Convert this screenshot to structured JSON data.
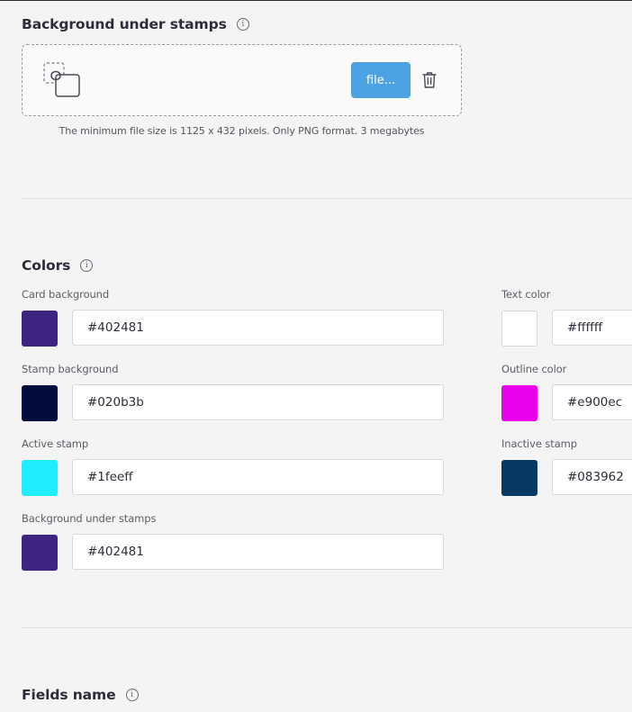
{
  "background_section": {
    "title": "Background under stamps",
    "file_button_label": "file...",
    "hint": "The minimum file size is 1125 x 432 pixels. Only PNG format. 3 megabytes"
  },
  "colors_section": {
    "title": "Colors",
    "fields": {
      "card_background": {
        "label": "Card background",
        "value": "#402481",
        "swatch": "#402481"
      },
      "text_color": {
        "label": "Text color",
        "value": "#ffffff",
        "swatch": "#ffffff"
      },
      "stamp_background": {
        "label": "Stamp background",
        "value": "#020b3b",
        "swatch": "#020b3b"
      },
      "outline_color": {
        "label": "Outline color",
        "value": "#e900ec",
        "swatch": "#e900ec"
      },
      "active_stamp": {
        "label": "Active stamp",
        "value": "#1feeff",
        "swatch": "#1feeff"
      },
      "inactive_stamp": {
        "label": "Inactive stamp",
        "value": "#083962",
        "swatch": "#083962"
      },
      "background_under_stamps": {
        "label": "Background under stamps",
        "value": "#402481",
        "swatch": "#402481"
      }
    }
  },
  "fields_section": {
    "title": "Fields name"
  },
  "icons": {
    "info": "info-icon",
    "upload_placeholder": "image-placeholder-icon",
    "trash": "trash-icon"
  },
  "theme": {
    "accent": "#4da2e4",
    "background": "#f4f4f4"
  }
}
